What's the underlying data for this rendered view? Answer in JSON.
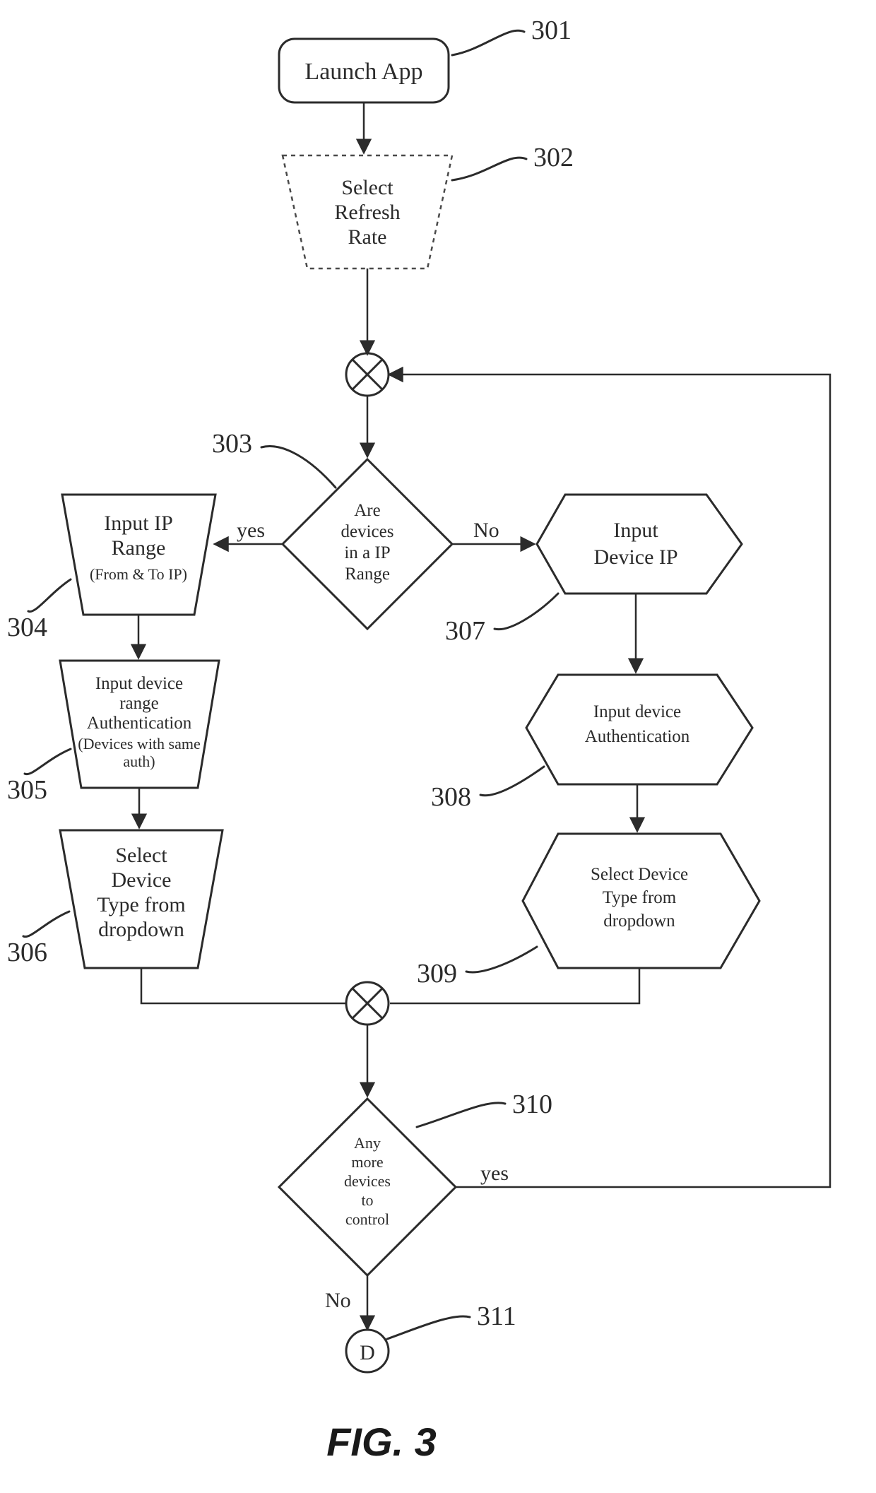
{
  "figure_title": "FIG. 3",
  "nodes": {
    "n301": {
      "label_num": "301",
      "lines": [
        "Launch App"
      ]
    },
    "n302": {
      "label_num": "302",
      "lines": [
        "Select",
        "Refresh",
        "Rate"
      ]
    },
    "n303": {
      "label_num": "303",
      "lines": [
        "Are",
        "devices",
        "in a IP",
        "Range"
      ]
    },
    "n304": {
      "label_num": "304",
      "lines": [
        "Input IP",
        "Range",
        "(From & To IP)"
      ]
    },
    "n305": {
      "label_num": "305",
      "lines": [
        "Input device",
        "range",
        "Authentication",
        "(Devices with same",
        "auth)"
      ]
    },
    "n306": {
      "label_num": "306",
      "lines": [
        "Select",
        "Device",
        "Type from",
        "dropdown"
      ]
    },
    "n307": {
      "label_num": "307",
      "lines": [
        "Input",
        "Device IP"
      ]
    },
    "n308": {
      "label_num": "308",
      "lines": [
        "Input device",
        "Authentication"
      ]
    },
    "n309": {
      "label_num": "309",
      "lines": [
        "Select Device",
        "Type from",
        "dropdown"
      ]
    },
    "n310": {
      "label_num": "310",
      "lines": [
        "Any",
        "more",
        "devices",
        "to",
        "control"
      ]
    },
    "n311": {
      "label_num": "311",
      "lines": [
        "D"
      ]
    }
  },
  "edge_labels": {
    "e303_yes": "yes",
    "e303_no": "No",
    "e310_yes": "yes",
    "e310_no": "No"
  }
}
